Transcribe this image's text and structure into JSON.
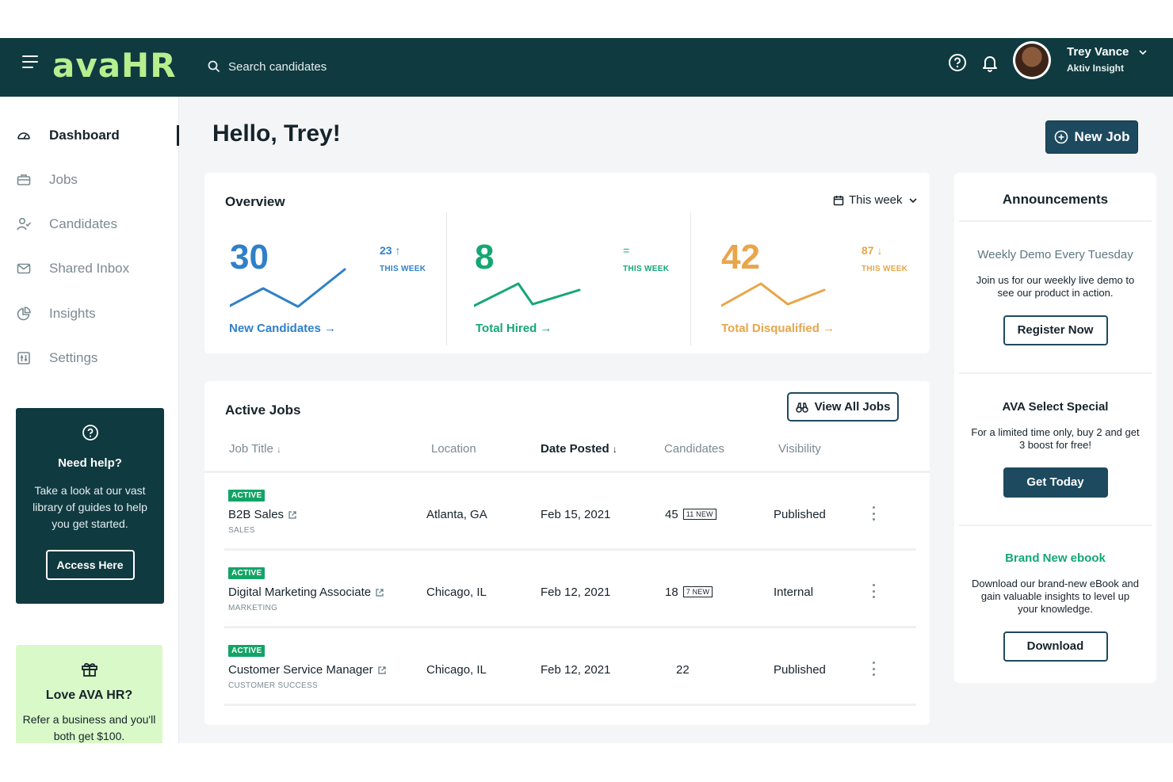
{
  "app": {
    "logo": "avaHR",
    "search_placeholder": "Search candidates",
    "user": {
      "name": "Trey Vance",
      "org": "Aktiv Insight"
    }
  },
  "sidebar": {
    "items": [
      {
        "label": "Dashboard",
        "icon": "gauge-icon"
      },
      {
        "label": "Jobs",
        "icon": "briefcase-icon"
      },
      {
        "label": "Candidates",
        "icon": "user-check-icon"
      },
      {
        "label": "Shared Inbox",
        "icon": "envelope-icon"
      },
      {
        "label": "Insights",
        "icon": "pie-chart-icon"
      },
      {
        "label": "Settings",
        "icon": "sliders-icon"
      }
    ],
    "help": {
      "title": "Need help?",
      "text": "Take a look at our vast library of guides to help you get started.",
      "button": "Access Here"
    },
    "refer": {
      "title": "Love AVA HR?",
      "text": "Refer a business and you'll both get $100."
    }
  },
  "main": {
    "greeting": "Hello, Trey!",
    "new_job_label": "New Job",
    "overview": {
      "title": "Overview",
      "filter": "This week",
      "metrics": [
        {
          "value": "30",
          "delta": "23",
          "delta_dir": "up",
          "week_label": "THIS WEEK",
          "link": "New Candidates",
          "color": "#2f80c9"
        },
        {
          "value": "8",
          "delta": "=",
          "delta_dir": "none",
          "week_label": "THIS WEEK",
          "link": "Total Hired",
          "color": "#14a774"
        },
        {
          "value": "42",
          "delta": "87",
          "delta_dir": "down",
          "week_label": "THIS WEEK",
          "link": "Total Disqualified",
          "color": "#e8a64a"
        }
      ]
    },
    "jobs": {
      "title": "Active Jobs",
      "view_all": "View All Jobs",
      "columns": [
        "Job Title",
        "Location",
        "Date Posted",
        "Candidates",
        "Visibility"
      ],
      "rows": [
        {
          "status": "ACTIVE",
          "title": "B2B Sales",
          "dept": "SALES",
          "location": "Atlanta, GA",
          "date": "Feb 15, 2021",
          "candidates": "45",
          "new": "11 NEW",
          "visibility": "Published"
        },
        {
          "status": "ACTIVE",
          "title": "Digital Marketing Associate",
          "dept": "MARKETING",
          "location": "Chicago, IL",
          "date": "Feb 12, 2021",
          "candidates": "18",
          "new": "7 NEW",
          "visibility": "Internal"
        },
        {
          "status": "ACTIVE",
          "title": "Customer Service Manager",
          "dept": "CUSTOMER SUCCESS",
          "location": "Chicago, IL",
          "date": "Feb 12, 2021",
          "candidates": "22",
          "new": "",
          "visibility": "Published"
        }
      ]
    }
  },
  "announcements": {
    "title": "Announcements",
    "items": [
      {
        "title": "Weekly Demo Every Tuesday",
        "text": "Join us for our weekly live demo to see our product in action.",
        "button": "Register Now",
        "title_color": "#5d7880"
      },
      {
        "title": "AVA Select Special",
        "text": "For a limited time only, buy 2 and get 3 boost for free!",
        "button": "Get Today",
        "title_color": "#16232b"
      },
      {
        "title": "Brand New ebook",
        "text": "Download our brand-new eBook and gain valuable insights to level up your knowledge.",
        "button": "Download",
        "title_color": "#14a774"
      }
    ]
  },
  "colors": {
    "brand_dark": "#0f3a40",
    "brand_light": "#b7ef8f",
    "button": "#1d4a5f",
    "badge": "#12a466"
  }
}
